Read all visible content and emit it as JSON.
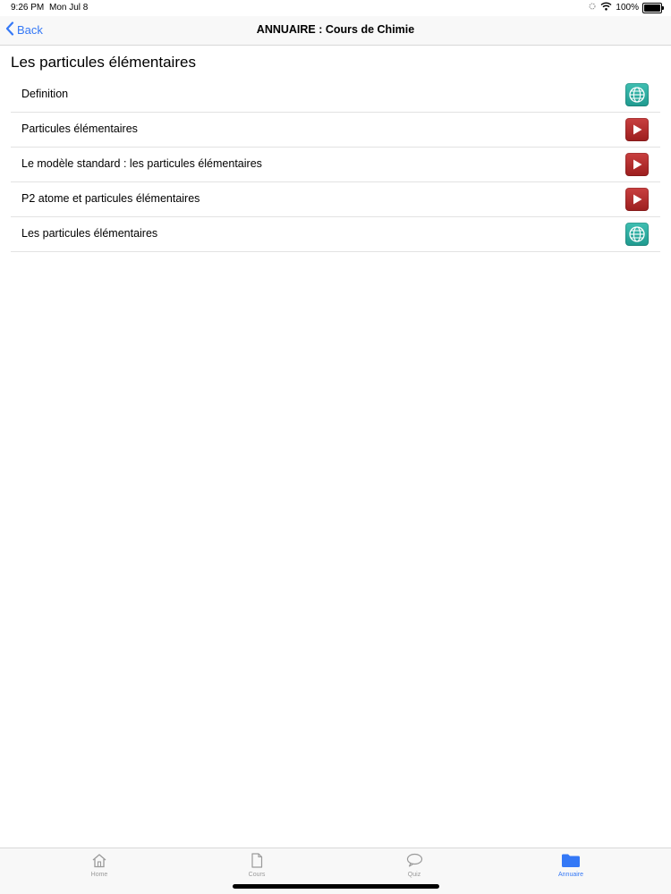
{
  "status_bar": {
    "time": "9:26 PM",
    "date": "Mon Jul 8",
    "battery": "100%"
  },
  "nav": {
    "back_label": "Back",
    "title": "ANNUAIRE : Cours de Chimie"
  },
  "section": {
    "title": "Les particules élémentaires"
  },
  "items": [
    {
      "label": "Definition",
      "icon": "globe-icon"
    },
    {
      "label": "Particules élémentaires",
      "icon": "video-play-icon"
    },
    {
      "label": "Le modèle standard : les particules élémentaires",
      "icon": "video-play-icon"
    },
    {
      "label": "P2 atome et particules élémentaires",
      "icon": "video-play-icon"
    },
    {
      "label": "Les particules élémentaires",
      "icon": "globe-icon"
    }
  ],
  "tabs": [
    {
      "label": "Home",
      "icon": "home-icon",
      "active": false
    },
    {
      "label": "Cours",
      "icon": "document-icon",
      "active": false
    },
    {
      "label": "Quiz",
      "icon": "speech-bubble-icon",
      "active": false
    },
    {
      "label": "Annuaire",
      "icon": "folder-icon",
      "active": true
    }
  ],
  "colors": {
    "accent": "#3478f6",
    "globe_icon_bg": "#2aa89c",
    "video_icon_bg": "#b32c2c",
    "inactive_tab": "#9a9a9a"
  }
}
